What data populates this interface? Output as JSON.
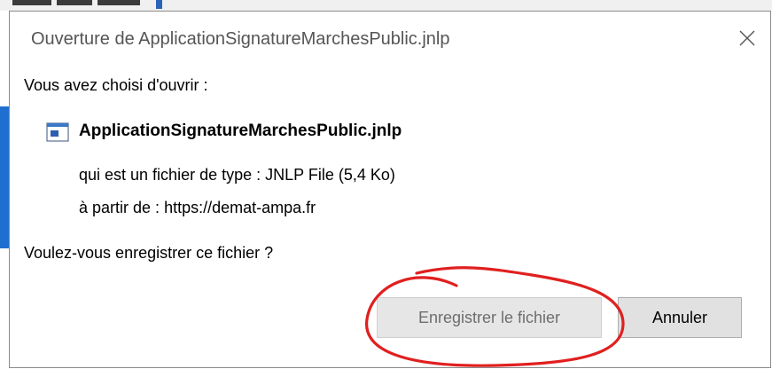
{
  "dialog": {
    "title": "Ouverture de ApplicationSignatureMarchesPublic.jnlp",
    "close_icon": "close-icon",
    "prompt": "Vous avez choisi d'ouvrir :",
    "file": {
      "icon": "jnlp-file-icon",
      "name": "ApplicationSignatureMarchesPublic.jnlp",
      "type_label": "qui est un fichier de type :",
      "type_value": "JNLP File (5,4 Ko)",
      "from_label": "à partir de :",
      "from_value": "https://demat-ampa.fr"
    },
    "question": "Voulez-vous enregistrer ce fichier ?",
    "buttons": {
      "save_label": "Enregistrer le fichier",
      "save_disabled": true,
      "cancel_label": "Annuler"
    }
  },
  "colors": {
    "annotation": "#e0201f",
    "title_text": "#555555",
    "disabled_text": "#6e6e6e"
  }
}
